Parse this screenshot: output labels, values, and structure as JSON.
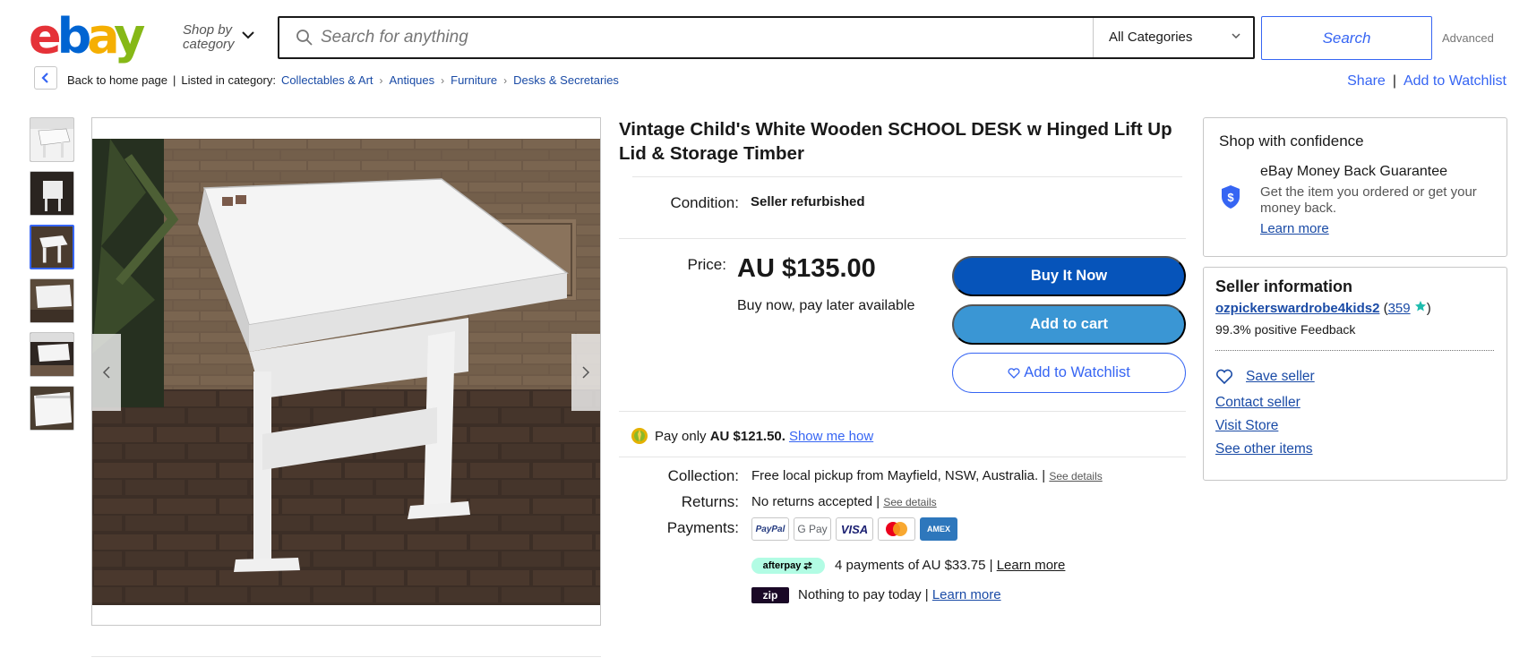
{
  "header": {
    "logo": [
      "e",
      "b",
      "a",
      "y"
    ],
    "shop_by_line1": "Shop by",
    "shop_by_line2": "category",
    "search_placeholder": "Search for anything",
    "category_select": "All Categories",
    "search_button": "Search",
    "advanced": "Advanced"
  },
  "breadcrumb": {
    "back": "Back to home page",
    "listed": "Listed in category:",
    "items": [
      "Collectables & Art",
      "Antiques",
      "Furniture",
      "Desks & Secretaries"
    ]
  },
  "actions": {
    "share": "Share",
    "watchlist": "Add to Watchlist"
  },
  "gallery": {
    "thumbnail_count": 6,
    "selected_index": 2
  },
  "listing": {
    "title": "Vintage Child's White Wooden SCHOOL DESK w Hinged Lift Up Lid & Storage Timber",
    "condition_label": "Condition:",
    "condition": "Seller refurbished",
    "price_label": "Price:",
    "price": "AU $135.00",
    "price_sub": "Buy now, pay later available",
    "buy_now": "Buy It Now",
    "add_to_cart": "Add to cart",
    "add_to_watchlist": "Add to Watchlist",
    "pay_only_prefix": "Pay only",
    "pay_only_amount": "AU $121.50.",
    "show_me_how": "Show me how",
    "collection_label": "Collection:",
    "collection": "Free local pickup from Mayfield, NSW, Australia. |",
    "see_details": "See details",
    "returns_label": "Returns:",
    "returns": "No returns accepted |",
    "payments_label": "Payments:",
    "payment_methods": [
      "PayPal",
      "G Pay",
      "VISA",
      "Mastercard",
      "AMEX"
    ],
    "afterpay_badge": "afterpay",
    "afterpay_text": "4 payments of AU $33.75 |",
    "zip_badge": "zip",
    "zip_text": "Nothing to pay today |",
    "learn_more": "Learn more"
  },
  "confidence": {
    "title": "Shop with confidence",
    "guarantee_title": "eBay Money Back Guarantee",
    "guarantee_desc": "Get the item you ordered or get your money back.",
    "learn_more": "Learn more"
  },
  "seller": {
    "title": "Seller information",
    "name": "ozpickerswardrobe4kids2",
    "feedback_count": "359",
    "feedback": "99.3% positive Feedback",
    "save": "Save seller",
    "contact": "Contact seller",
    "store": "Visit Store",
    "other": "See other items"
  },
  "colors": {
    "brand_blue": "#3665f3",
    "buy_now": "#0654ba",
    "add_to_cart": "#3a96d4",
    "link": "#1a4ba6",
    "logo_red": "#e53238",
    "logo_blue": "#0064d2",
    "logo_yellow": "#f5af02",
    "logo_green": "#86b817"
  }
}
